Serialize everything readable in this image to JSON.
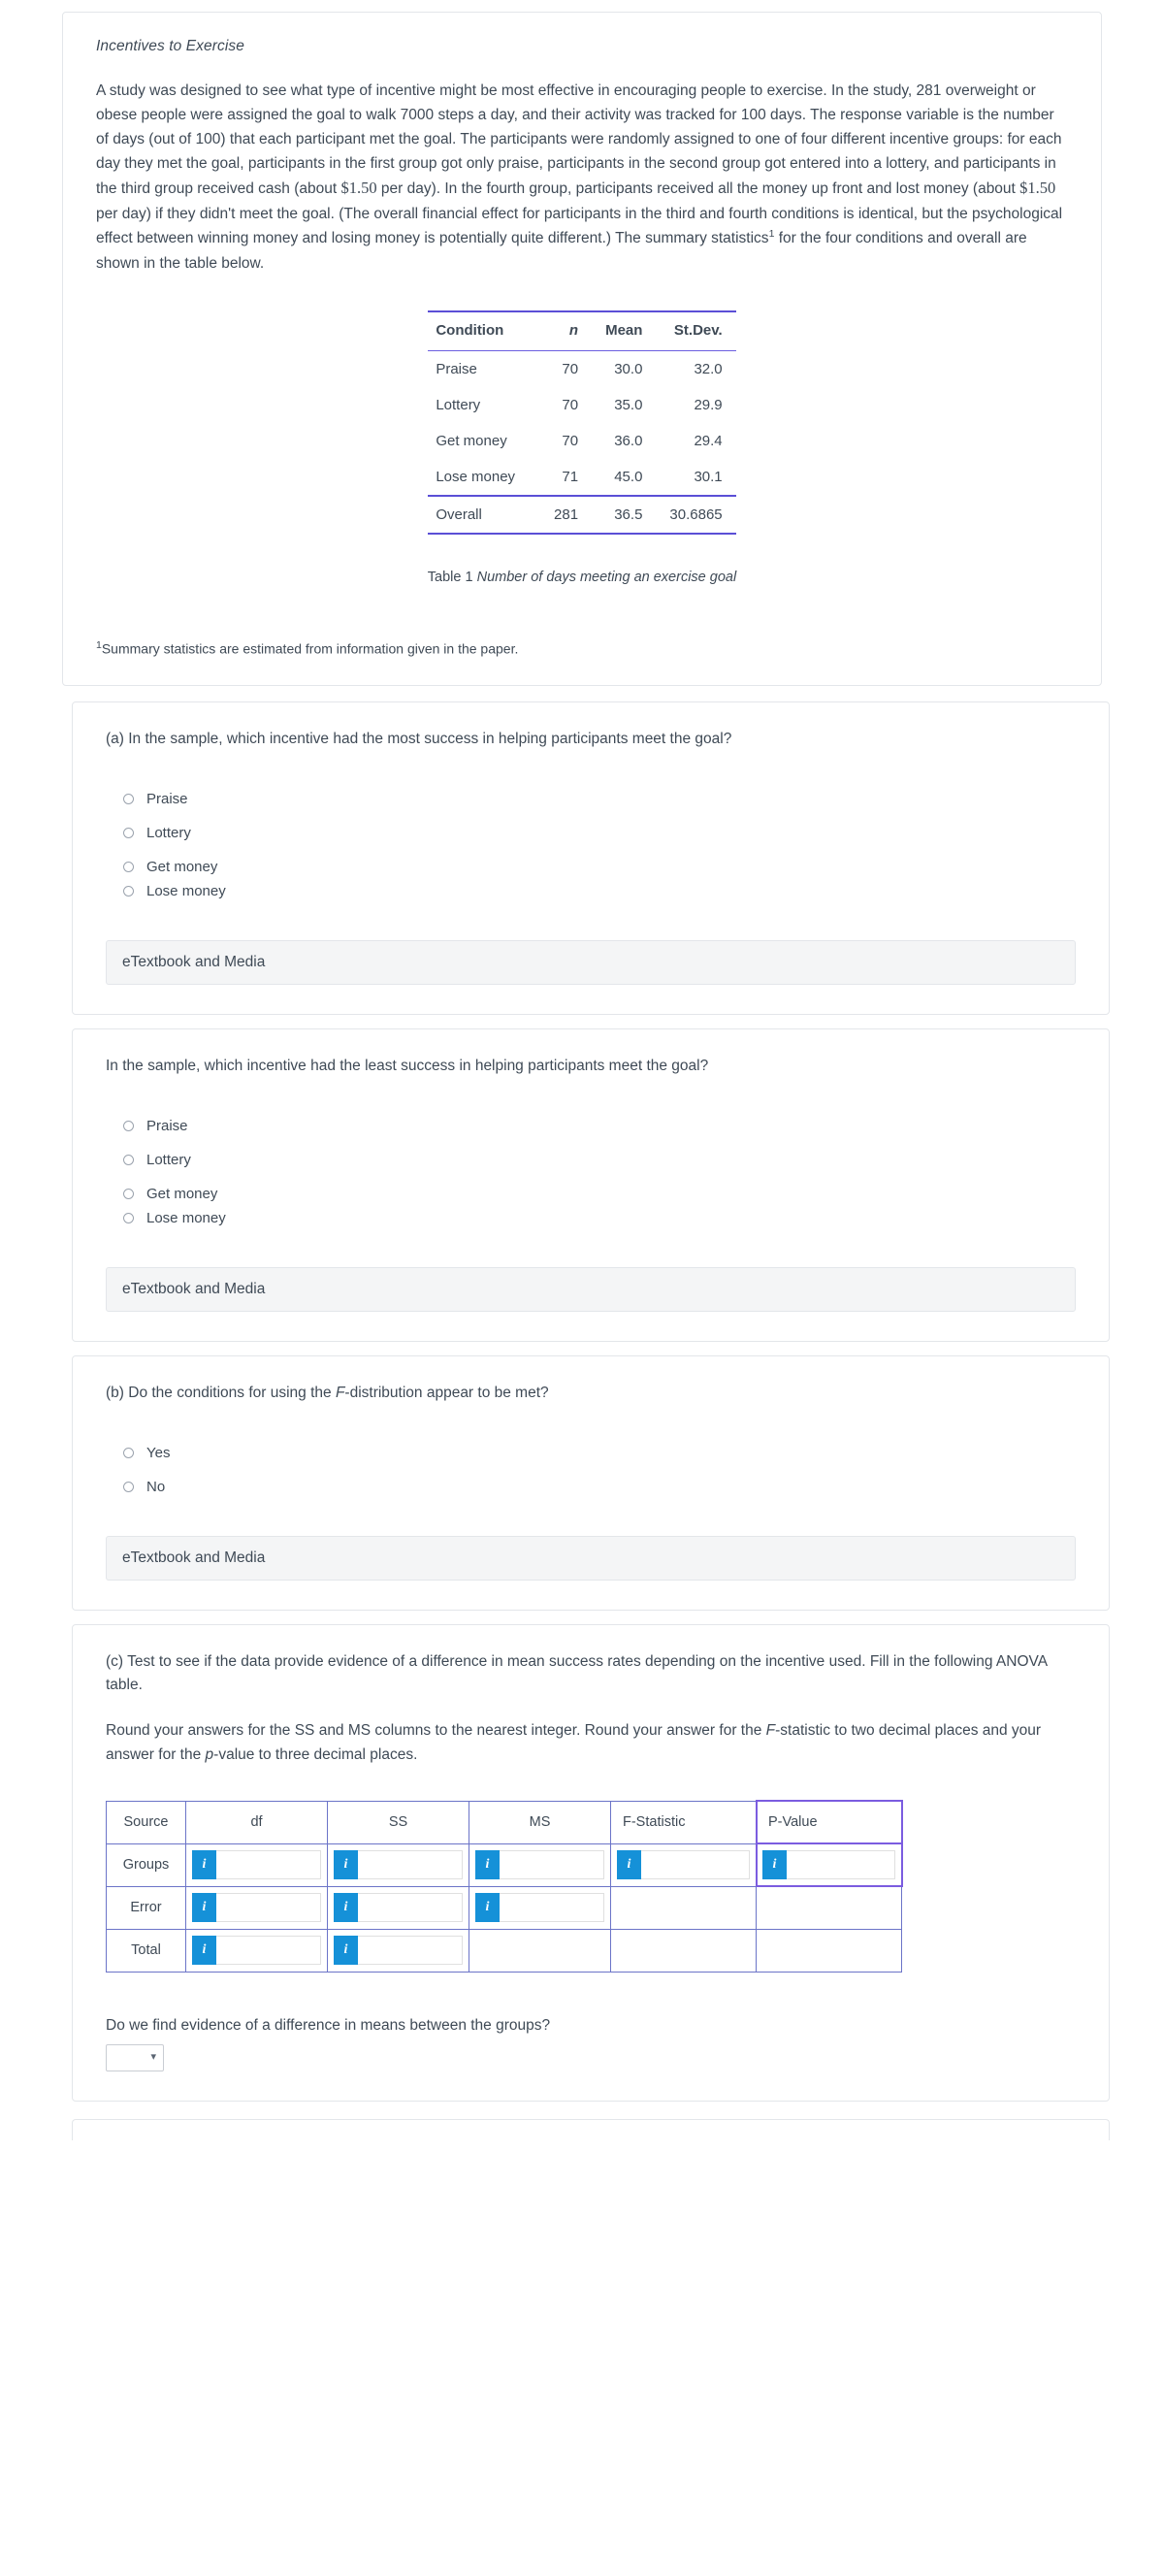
{
  "intro": {
    "title": "Incentives to Exercise",
    "paragraph_pre": "A study was designed to see what type of incentive might be most effective in encouraging people to exercise. In the study, 281 overweight or obese people were assigned the goal to walk 7000 steps a day, and their activity was tracked for 100 days. The response variable is the number of days (out of 100) that each participant met the goal. The participants were randomly assigned to one of four different incentive groups: for each day they met the goal, participants in the first group got only praise, participants in the second group got entered into a lottery, and participants in the third group received cash (about ",
    "money1": "$1.50",
    "paragraph_mid": " per day). In the fourth group, participants received all the money up front and lost money (about ",
    "money2": "$1.50",
    "paragraph_mid2": " per day) if they didn't meet the goal. (The overall financial effect for participants in the third and fourth conditions is identical, but the psychological effect between winning money and losing money is potentially quite different.) The summary statistics",
    "footnote_marker": "1",
    "paragraph_post": " for the four conditions and overall are shown in the table below.",
    "footnote": "Summary statistics are estimated from information given in the paper.",
    "footnote_sup": "1"
  },
  "summary_table": {
    "headers": [
      "Condition",
      "n",
      "Mean",
      "St.Dev."
    ],
    "rows": [
      {
        "condition": "Praise",
        "n": "70",
        "mean": "30.0",
        "sd": "32.0"
      },
      {
        "condition": "Lottery",
        "n": "70",
        "mean": "35.0",
        "sd": "29.9"
      },
      {
        "condition": "Get money",
        "n": "70",
        "mean": "36.0",
        "sd": "29.4"
      },
      {
        "condition": "Lose money",
        "n": "71",
        "mean": "45.0",
        "sd": "30.1"
      }
    ],
    "overall": {
      "condition": "Overall",
      "n": "281",
      "mean": "36.5",
      "sd": "30.6865"
    },
    "caption_label": "Table 1",
    "caption_text": "Number of days meeting an exercise goal"
  },
  "qa": {
    "prompt": "(a) In the sample, which incentive had the most success in helping participants meet the goal?",
    "options": [
      "Praise",
      "Lottery",
      "Get money",
      "Lose money"
    ],
    "etextbook": "eTextbook and Media"
  },
  "qa2": {
    "prompt": "In the sample, which incentive had the least success in helping participants meet the goal?",
    "options": [
      "Praise",
      "Lottery",
      "Get money",
      "Lose money"
    ],
    "etextbook": "eTextbook and Media"
  },
  "qb": {
    "prompt_pre": "(b) Do the conditions for using the ",
    "prompt_ital": "F",
    "prompt_post": "-distribution appear to be met?",
    "options": [
      "Yes",
      "No"
    ],
    "etextbook": "eTextbook and Media"
  },
  "qc": {
    "prompt_line1": "(c) Test to see if the data provide evidence of a difference in mean success rates depending on the incentive used. Fill in the following ANOVA table.",
    "prompt_line2_pre": "Round your answers for the SS and MS columns to the nearest integer. Round your answer for the ",
    "prompt_line2_ital1": "F",
    "prompt_line2_mid": "-statistic to two decimal places and your answer for the ",
    "prompt_line2_ital2": "p",
    "prompt_line2_post": "-value to three decimal places.",
    "anova": {
      "headers": [
        "Source",
        "df",
        "SS",
        "MS",
        "F-Statistic",
        "P-Value"
      ],
      "rows": [
        {
          "source": "Groups",
          "cells": [
            "input",
            "input",
            "input",
            "input",
            "input"
          ]
        },
        {
          "source": "Error",
          "cells": [
            "input",
            "input",
            "input",
            "empty",
            "empty"
          ]
        },
        {
          "source": "Total",
          "cells": [
            "input",
            "input",
            "empty",
            "empty",
            "empty"
          ]
        }
      ],
      "info_icon": "i"
    },
    "evidence_question": "Do we find evidence of a difference in means between the groups?",
    "select_value": "",
    "select_chevron": "chevron-down-icon"
  },
  "colors": {
    "rule": "#5b4fd6",
    "anova_border": "#6b74c8",
    "info_blue": "#1591d8",
    "text": "#3f4a56",
    "panel_bg": "#f4f5f6"
  }
}
